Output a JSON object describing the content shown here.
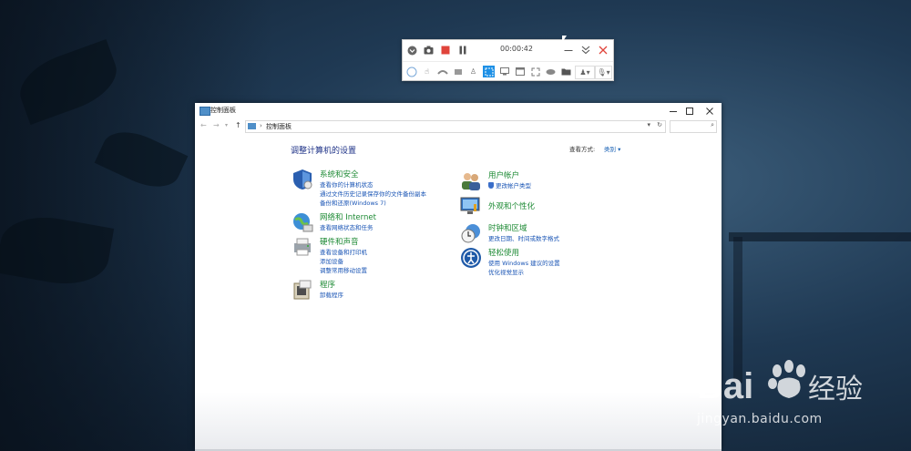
{
  "recorder": {
    "time": "00:00:42"
  },
  "window": {
    "title": "控制面板",
    "address": "控制面板",
    "heading": "调整计算机的设置",
    "view_by_label": "查看方式:",
    "view_by_value": "类别 ▾"
  },
  "categories": {
    "system": {
      "title": "系统和安全",
      "links": [
        "查看你的计算机状态",
        "通过文件历史记录保存你的文件备份副本",
        "备份和还原(Windows 7)"
      ]
    },
    "network": {
      "title": "网络和 Internet",
      "links": [
        "查看网络状态和任务"
      ]
    },
    "hardware": {
      "title": "硬件和声音",
      "links": [
        "查看设备和打印机",
        "添加设备",
        "调整常用移动设置"
      ]
    },
    "programs": {
      "title": "程序",
      "links": [
        "卸载程序"
      ]
    },
    "users": {
      "title": "用户帐户",
      "links": [
        "更改帐户类型"
      ]
    },
    "appearance": {
      "title": "外观和个性化",
      "links": []
    },
    "clock": {
      "title": "时钟和区域",
      "links": [
        "更改日期、时间或数字格式"
      ]
    },
    "ease": {
      "title": "轻松使用",
      "links": [
        "使用 Windows 建议的设置",
        "优化视觉显示"
      ]
    }
  },
  "watermark": {
    "line": "jingyan.baidu.com"
  }
}
